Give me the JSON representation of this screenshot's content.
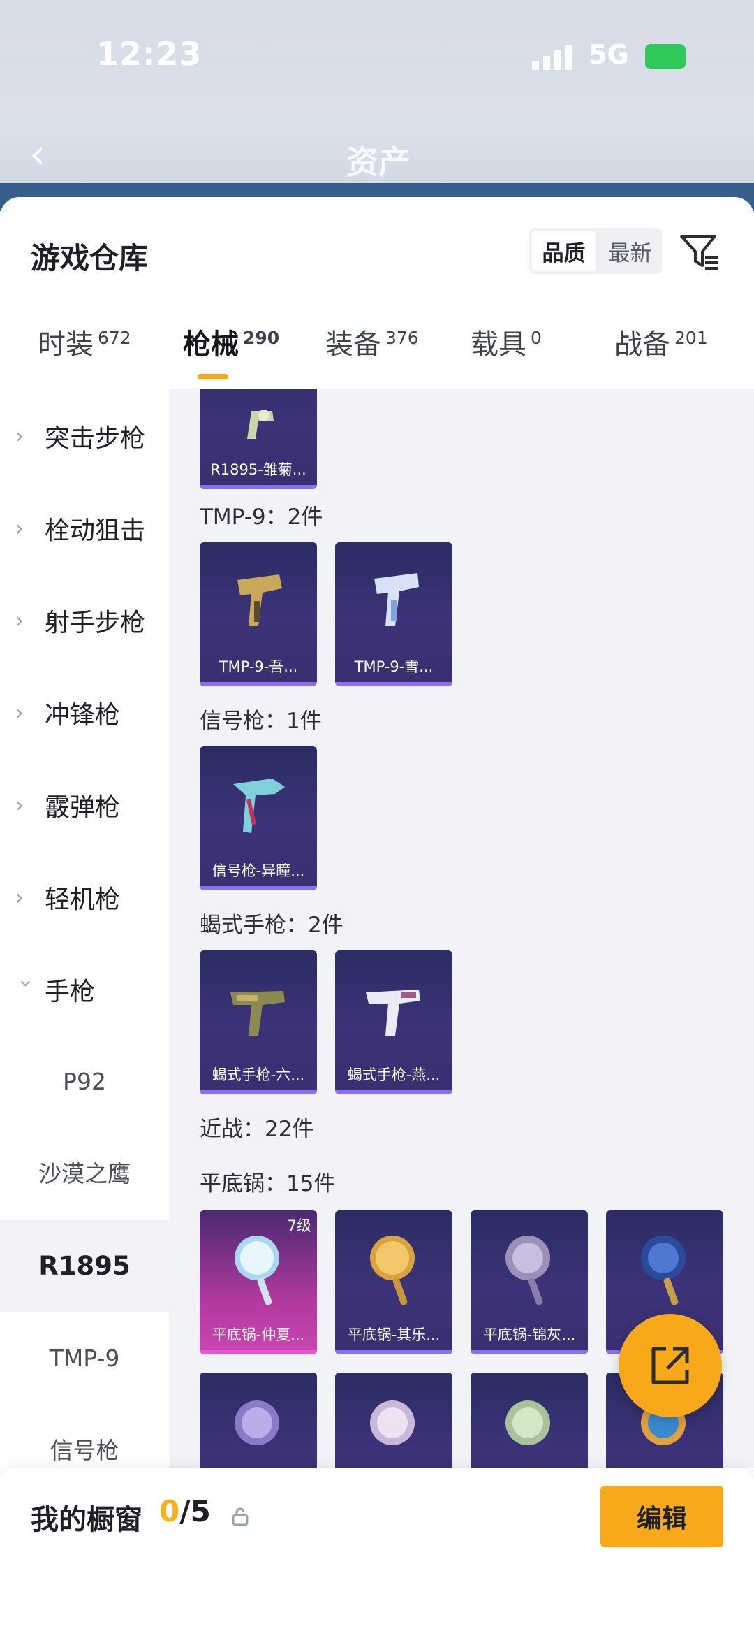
{
  "status_bar": {
    "time": "12:23",
    "network": "5G",
    "battery": "88"
  },
  "header": {
    "title": "资产",
    "back_icon": "back-arrow-icon"
  },
  "warehouse": {
    "title": "游戏仓库",
    "sort_options": [
      "品质",
      "最新"
    ],
    "sort_active": "品质",
    "filter_icon": "filter-icon"
  },
  "tabs": [
    {
      "label": "时装",
      "count": "672"
    },
    {
      "label": "枪械",
      "count": "290",
      "active": true
    },
    {
      "label": "装备",
      "count": "376"
    },
    {
      "label": "载具",
      "count": "0"
    },
    {
      "label": "战备",
      "count": "201"
    }
  ],
  "sidebar": {
    "categories": [
      "突击步枪",
      "栓动狙击",
      "射手步枪",
      "冲锋枪",
      "霰弹枪",
      "轻机枪",
      "手枪"
    ],
    "subitems": [
      "P92",
      "沙漠之鹰",
      "R1895",
      "TMP-9",
      "信号枪"
    ],
    "active_sub": "R1895"
  },
  "content": {
    "top_card": "R1895-雏菊...",
    "groups": [
      {
        "label": "TMP-9：2件",
        "cards": [
          "TMP-9-吾...",
          "TMP-9-雪..."
        ]
      },
      {
        "label": "信号枪：1件",
        "cards": [
          "信号枪-异瞳..."
        ]
      },
      {
        "label": "蝎式手枪：2件",
        "cards": [
          "蝎式手枪-六...",
          "蝎式手枪-燕..."
        ]
      },
      {
        "label": "近战：22件"
      },
      {
        "label": "平底锅：15件",
        "cards": [
          "平底锅-仲夏...",
          "平底锅-其乐...",
          "平底锅-锦灰...",
          "平"
        ]
      }
    ],
    "level_badge": "7级"
  },
  "showcase": {
    "label": "我的橱窗",
    "current": "0",
    "total": "/5",
    "edit_label": "编辑"
  },
  "colors": {
    "accent": "#f7a81b",
    "card_purple": "#3c3378",
    "card_pink": "#c845b0"
  }
}
